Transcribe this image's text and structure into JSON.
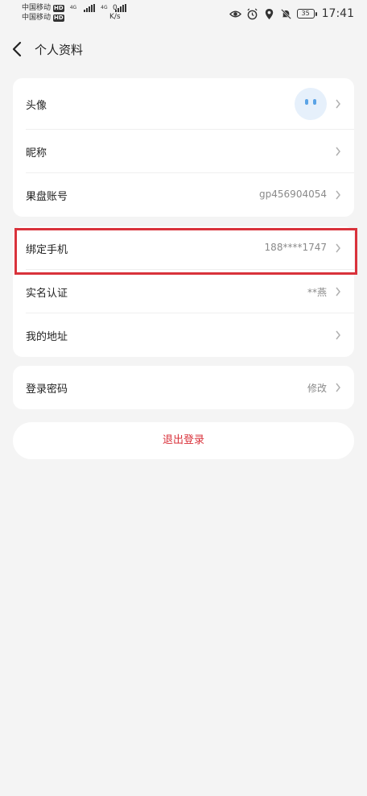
{
  "status_bar": {
    "carrier1": "中国移动",
    "carrier2": "中国移动",
    "hd": "HD",
    "net": "4G",
    "speed_value": "0",
    "speed_unit": "K/s",
    "battery": "35",
    "time": "17:41",
    "icons": [
      "eye-icon",
      "alarm-icon",
      "location-icon",
      "mute-bell-icon"
    ]
  },
  "header": {
    "title": "个人资料",
    "back_icon": "chevron-left-icon"
  },
  "group1": {
    "avatar_label": "头像",
    "nickname_label": "昵称",
    "account_label": "果盘账号",
    "account_value": "gp456904054"
  },
  "group2": {
    "phone_label": "绑定手机",
    "phone_value": "188****1747",
    "realname_label": "实名认证",
    "realname_value": "**燕",
    "address_label": "我的地址"
  },
  "group3": {
    "password_label": "登录密码",
    "password_value": "修改"
  },
  "logout_label": "退出登录",
  "colors": {
    "background": "#f4f4f4",
    "card": "#ffffff",
    "accent_red": "#d9323b",
    "secondary_text": "#8a8a8a",
    "avatar_bg": "#e6f0fb",
    "avatar_eyes": "#5aa3e6"
  }
}
